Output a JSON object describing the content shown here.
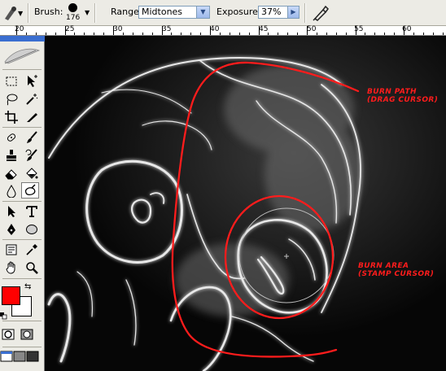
{
  "options_bar": {
    "brush_label": "Brush:",
    "brush_size": "176",
    "range_label": "Range:",
    "range_value": "Midtones",
    "exposure_label": "Exposure:",
    "exposure_value": "37%"
  },
  "ruler": {
    "labels": [
      "20",
      "25",
      "30",
      "35",
      "40",
      "45",
      "50",
      "55",
      "60"
    ]
  },
  "annotations": {
    "burn_path_line1": "BURN PATH",
    "burn_path_line2": "(DRAG CURSOR)",
    "burn_area_line1": "BURN AREA",
    "burn_area_line2": "(STAMP CURSOR)"
  },
  "colors": {
    "foreground": "#ff0000",
    "background": "#ffffff",
    "annotation": "#ff1c1c"
  },
  "toolbox": {
    "tools": [
      "marquee-tool",
      "move-tool",
      "lasso-tool",
      "magic-wand-tool",
      "crop-tool",
      "slice-tool",
      "healing-brush-tool",
      "brush-tool",
      "clone-stamp-tool",
      "history-brush-tool",
      "eraser-tool",
      "paint-bucket-tool",
      "blur-tool",
      "burn-tool",
      "path-selection-tool",
      "type-tool",
      "pen-tool",
      "shape-tool",
      "notes-tool",
      "eyedropper-tool",
      "hand-tool",
      "zoom-tool"
    ],
    "active_tool": "burn-tool"
  }
}
